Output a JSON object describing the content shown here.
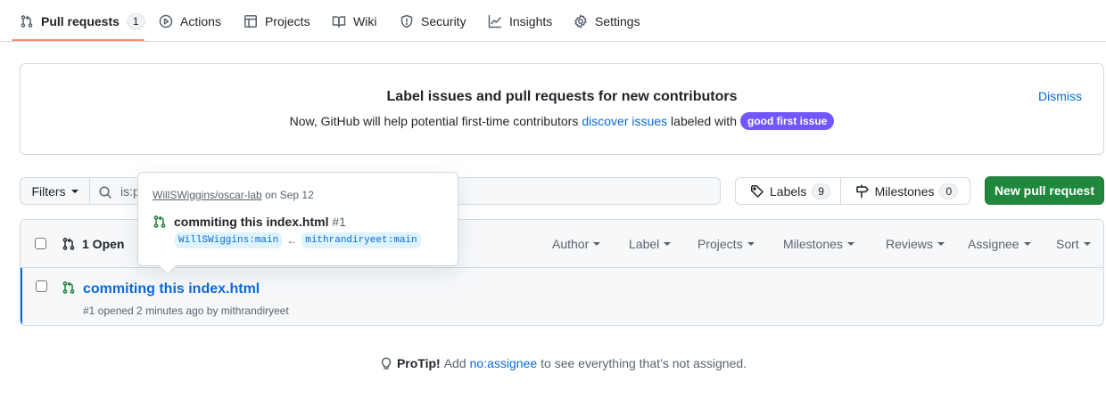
{
  "nav": {
    "pull_requests": {
      "label": "Pull requests",
      "count": "1"
    },
    "actions": "Actions",
    "projects": "Projects",
    "wiki": "Wiki",
    "security": "Security",
    "insights": "Insights",
    "settings": "Settings"
  },
  "banner": {
    "title": "Label issues and pull requests for new contributors",
    "text_before": "Now, GitHub will help potential first-time contributors",
    "link": "discover issues",
    "text_after": "labeled with",
    "label": "good first issue",
    "dismiss": "Dismiss"
  },
  "filter_bar": {
    "filters_label": "Filters",
    "search_value": "is:p",
    "labels_label": "Labels",
    "labels_count": "9",
    "milestones_label": "Milestones",
    "milestones_count": "0",
    "new_pr_label": "New pull request"
  },
  "list": {
    "open_label": "1 Open",
    "filters": [
      "Author",
      "Label",
      "Projects",
      "Milestones",
      "Reviews",
      "Assignee",
      "Sort"
    ],
    "rows": [
      {
        "title": "commiting this index.html",
        "meta": "#1 opened 2 minutes ago by mithrandiryeet"
      }
    ]
  },
  "popover": {
    "repo": "WillSWiggins/oscar-lab",
    "date": "on Sep 12",
    "title": "commiting this index.html",
    "number": "#1",
    "base_branch": "WillSWiggins:main",
    "arrow": "←",
    "head_branch": "mithrandiryeet:main"
  },
  "protip": {
    "label": "ProTip!",
    "before": "Add",
    "link": "no:assignee",
    "after": "to see everything that’s not assigned."
  },
  "colors": {
    "accent_link": "#0969da",
    "primary_button": "#1f883d",
    "tab_underline": "#fd8c73",
    "good_first_issue": "#7057ff",
    "open_pr_icon": "#1a7f37"
  }
}
